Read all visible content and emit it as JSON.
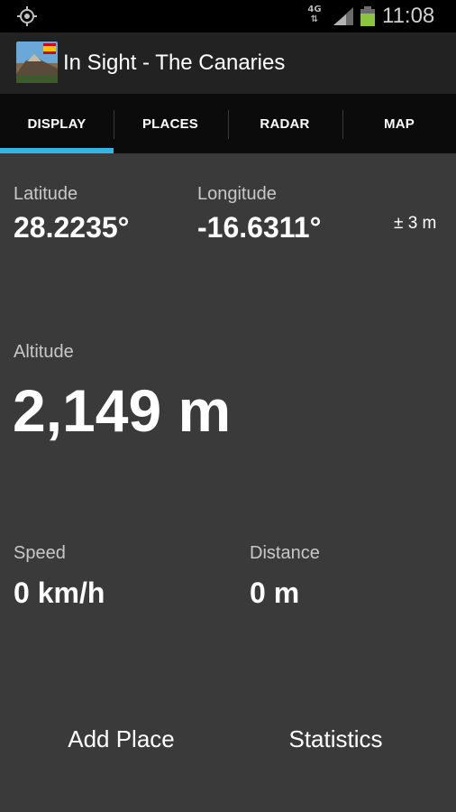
{
  "status_bar": {
    "location_icon": "gps-crosshair-icon",
    "network_type": "4G",
    "signal_icon": "signal-strength-icon",
    "battery_icon": "battery-icon",
    "battery_color": "#8bc53f",
    "time": "11:08"
  },
  "action_bar": {
    "app_icon": "app-landscape-flag-icon",
    "title": "In Sight - The Canaries"
  },
  "tabs": [
    {
      "label": "DISPLAY",
      "selected": true
    },
    {
      "label": "PLACES",
      "selected": false
    },
    {
      "label": "RADAR",
      "selected": false
    },
    {
      "label": "MAP",
      "selected": false
    }
  ],
  "accent_color": "#33b5e5",
  "readings": {
    "latitude": {
      "label": "Latitude",
      "value": "28.2235°"
    },
    "longitude": {
      "label": "Longitude",
      "value": "-16.6311°"
    },
    "accuracy": "± 3 m",
    "altitude": {
      "label": "Altitude",
      "value": "2,149 m"
    },
    "speed": {
      "label": "Speed",
      "value": "0 km/h"
    },
    "distance": {
      "label": "Distance",
      "value": "0 m"
    }
  },
  "actions": {
    "add_place": "Add Place",
    "statistics": "Statistics"
  }
}
